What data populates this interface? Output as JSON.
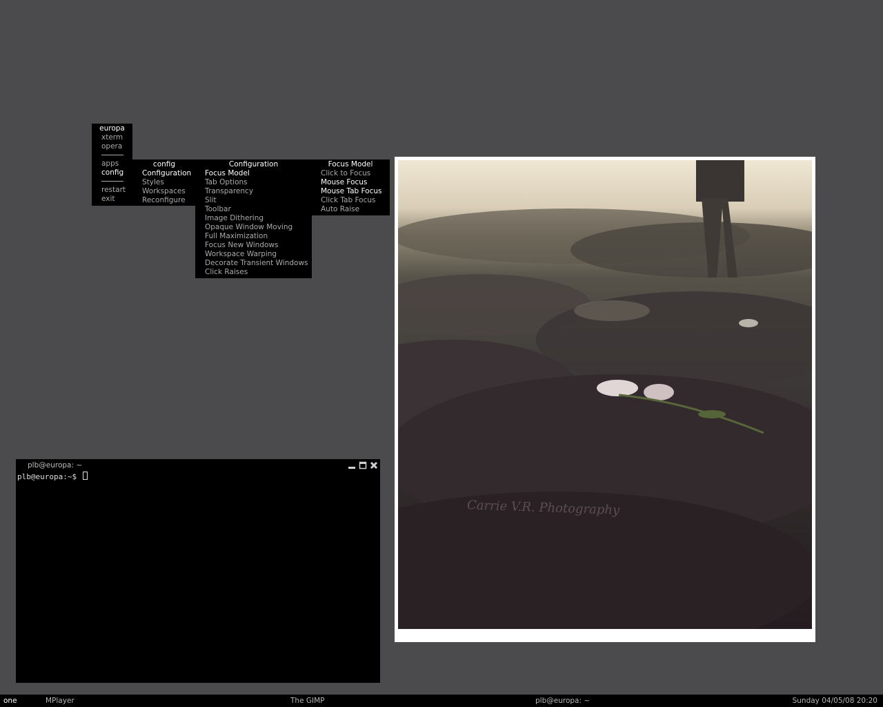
{
  "root_menu": {
    "title": "europa",
    "items_top": [
      "xterm",
      "opera"
    ],
    "items_mid": [
      "apps",
      "config"
    ],
    "items_bottom": [
      "restart",
      "exit"
    ]
  },
  "config_menu": {
    "title": "config",
    "items": [
      "Configuration",
      "Styles",
      "Workspaces",
      "Reconfigure"
    ]
  },
  "configuration_menu": {
    "title": "Configuration",
    "items": [
      "Focus Model",
      "Tab Options",
      "Transparency",
      "Slit",
      "Toolbar",
      "Image Dithering",
      "Opaque Window Moving",
      "Full Maximization",
      "Focus New Windows",
      "Workspace Warping",
      "Decorate Transient Windows",
      "Click Raises"
    ]
  },
  "focus_menu": {
    "title": "Focus Model",
    "items": [
      "Click to Focus",
      "Mouse Focus",
      "Mouse Tab Focus",
      "Click Tab Focus",
      "Auto Raise"
    ]
  },
  "terminal": {
    "title": "plb@europa: ~",
    "prompt": "plb@europa:~$ "
  },
  "photo": {
    "watermark": "Carrie V.R. Photography"
  },
  "taskbar": {
    "workspace": "one",
    "tasks": [
      "MPlayer",
      "The GIMP",
      "plb@europa: ~"
    ],
    "clock": "Sunday 04/05/08 20:20"
  },
  "colors": {
    "desktop": "#4b4b4d",
    "menu_bg": "#000000",
    "menu_text": "#a9a9a9",
    "menu_highlight": "#ffffff"
  }
}
